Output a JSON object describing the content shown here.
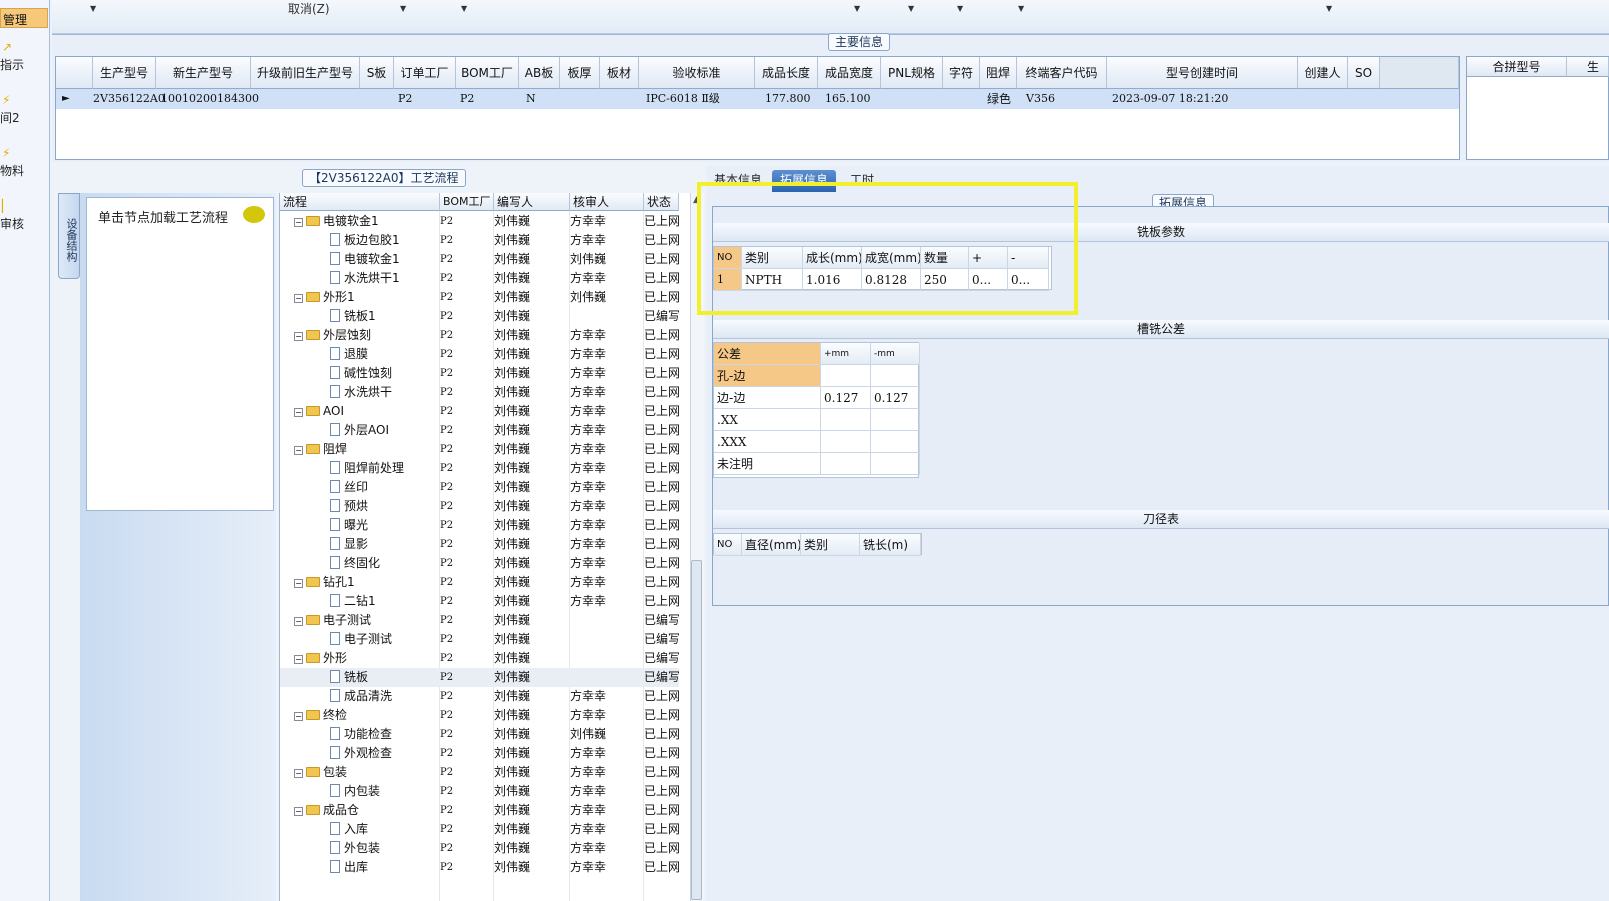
{
  "rail": {
    "items": [
      "管理",
      "指示",
      "间2",
      "物料",
      "审核"
    ]
  },
  "topbar": {
    "cancel": "取消(Z)"
  },
  "main": {
    "group_title": "主要信息",
    "columns": [
      "生产型号",
      "新生产型号",
      "升级前旧生产型号",
      "S板",
      "订单工厂",
      "BOM工厂",
      "AB板",
      "板厚",
      "板材",
      "验收标准",
      "成品长度",
      "成品宽度",
      "PNL规格",
      "字符",
      "阻焊",
      "终端客户代码",
      "型号创建时间",
      "创建人",
      "SO"
    ],
    "row": {
      "prod": "2V356122A0",
      "newprod": "10010200184300",
      "order_factory": "P2",
      "bom_factory": "P2",
      "ab": "N",
      "std": "IPC-6018 Ⅱ级",
      "len": "177.800",
      "wid": "165.100",
      "solder": "绿色",
      "customer": "V356",
      "created": "2023-09-07 18:21:20"
    },
    "merge_cols": [
      "合拼型号",
      "生"
    ]
  },
  "flow": {
    "title": "【2V356122A0】工艺流程",
    "vtab": "设备结构",
    "hint": "单击节点加载工艺流程",
    "columns": [
      "流程",
      "BOM工厂",
      "编写人",
      "核审人",
      "状态"
    ],
    "rows": [
      {
        "n": "电镀软金1",
        "lv": 0,
        "b": "P2",
        "w": "刘伟巍",
        "r": "方幸幸",
        "s": "已上网"
      },
      {
        "n": "板边包胶1",
        "lv": 1,
        "b": "P2",
        "w": "刘伟巍",
        "r": "方幸幸",
        "s": "已上网"
      },
      {
        "n": "电镀软金1",
        "lv": 1,
        "b": "P2",
        "w": "刘伟巍",
        "r": "刘伟巍",
        "s": "已上网"
      },
      {
        "n": "水洗烘干1",
        "lv": 1,
        "b": "P2",
        "w": "刘伟巍",
        "r": "方幸幸",
        "s": "已上网"
      },
      {
        "n": "外形1",
        "lv": 0,
        "b": "P2",
        "w": "刘伟巍",
        "r": "刘伟巍",
        "s": "已上网"
      },
      {
        "n": "铣板1",
        "lv": 1,
        "b": "P2",
        "w": "刘伟巍",
        "r": "",
        "s": "已编写"
      },
      {
        "n": "外层蚀刻",
        "lv": 0,
        "b": "P2",
        "w": "刘伟巍",
        "r": "方幸幸",
        "s": "已上网"
      },
      {
        "n": "退膜",
        "lv": 1,
        "b": "P2",
        "w": "刘伟巍",
        "r": "方幸幸",
        "s": "已上网"
      },
      {
        "n": "碱性蚀刻",
        "lv": 1,
        "b": "P2",
        "w": "刘伟巍",
        "r": "方幸幸",
        "s": "已上网"
      },
      {
        "n": "水洗烘干",
        "lv": 1,
        "b": "P2",
        "w": "刘伟巍",
        "r": "方幸幸",
        "s": "已上网"
      },
      {
        "n": "AOI",
        "lv": 0,
        "b": "P2",
        "w": "刘伟巍",
        "r": "方幸幸",
        "s": "已上网"
      },
      {
        "n": "外层AOI",
        "lv": 1,
        "b": "P2",
        "w": "刘伟巍",
        "r": "方幸幸",
        "s": "已上网"
      },
      {
        "n": "阻焊",
        "lv": 0,
        "b": "P2",
        "w": "刘伟巍",
        "r": "方幸幸",
        "s": "已上网"
      },
      {
        "n": "阻焊前处理",
        "lv": 1,
        "b": "P2",
        "w": "刘伟巍",
        "r": "方幸幸",
        "s": "已上网"
      },
      {
        "n": "丝印",
        "lv": 1,
        "b": "P2",
        "w": "刘伟巍",
        "r": "方幸幸",
        "s": "已上网"
      },
      {
        "n": "预烘",
        "lv": 1,
        "b": "P2",
        "w": "刘伟巍",
        "r": "方幸幸",
        "s": "已上网"
      },
      {
        "n": "曝光",
        "lv": 1,
        "b": "P2",
        "w": "刘伟巍",
        "r": "方幸幸",
        "s": "已上网"
      },
      {
        "n": "显影",
        "lv": 1,
        "b": "P2",
        "w": "刘伟巍",
        "r": "方幸幸",
        "s": "已上网"
      },
      {
        "n": "终固化",
        "lv": 1,
        "b": "P2",
        "w": "刘伟巍",
        "r": "方幸幸",
        "s": "已上网"
      },
      {
        "n": "钻孔1",
        "lv": 0,
        "b": "P2",
        "w": "刘伟巍",
        "r": "方幸幸",
        "s": "已上网"
      },
      {
        "n": "二钻1",
        "lv": 1,
        "b": "P2",
        "w": "刘伟巍",
        "r": "方幸幸",
        "s": "已上网"
      },
      {
        "n": "电子测试",
        "lv": 0,
        "b": "P2",
        "w": "刘伟巍",
        "r": "",
        "s": "已编写"
      },
      {
        "n": "电子测试",
        "lv": 1,
        "b": "P2",
        "w": "刘伟巍",
        "r": "",
        "s": "已编写"
      },
      {
        "n": "外形",
        "lv": 0,
        "b": "P2",
        "w": "刘伟巍",
        "r": "",
        "s": "已编写"
      },
      {
        "n": "铣板",
        "lv": 1,
        "b": "P2",
        "w": "刘伟巍",
        "r": "",
        "s": "已编写"
      },
      {
        "n": "成品清洗",
        "lv": 1,
        "b": "P2",
        "w": "刘伟巍",
        "r": "方幸幸",
        "s": "已上网"
      },
      {
        "n": "终检",
        "lv": 0,
        "b": "P2",
        "w": "刘伟巍",
        "r": "方幸幸",
        "s": "已上网"
      },
      {
        "n": "功能检查",
        "lv": 1,
        "b": "P2",
        "w": "刘伟巍",
        "r": "刘伟巍",
        "s": "已上网"
      },
      {
        "n": "外观检查",
        "lv": 1,
        "b": "P2",
        "w": "刘伟巍",
        "r": "方幸幸",
        "s": "已上网"
      },
      {
        "n": "包装",
        "lv": 0,
        "b": "P2",
        "w": "刘伟巍",
        "r": "方幸幸",
        "s": "已上网"
      },
      {
        "n": "内包装",
        "lv": 1,
        "b": "P2",
        "w": "刘伟巍",
        "r": "方幸幸",
        "s": "已上网"
      },
      {
        "n": "成品仓",
        "lv": 0,
        "b": "P2",
        "w": "刘伟巍",
        "r": "方幸幸",
        "s": "已上网"
      },
      {
        "n": "入库",
        "lv": 1,
        "b": "P2",
        "w": "刘伟巍",
        "r": "方幸幸",
        "s": "已上网"
      },
      {
        "n": "外包装",
        "lv": 1,
        "b": "P2",
        "w": "刘伟巍",
        "r": "方幸幸",
        "s": "已上网"
      },
      {
        "n": "出库",
        "lv": 1,
        "b": "P2",
        "w": "刘伟巍",
        "r": "方幸幸",
        "s": "已上网"
      }
    ]
  },
  "ext": {
    "tabs": [
      "基本信息",
      "拓展信息",
      "工时"
    ],
    "group_title": "拓展信息",
    "mill": {
      "title": "铣板参数",
      "headers": [
        "NO",
        "类别",
        "成长(mm)",
        "成宽(mm)",
        "数量",
        "+",
        "-"
      ],
      "row": [
        "1",
        "NPTH",
        "1.016",
        "0.8128",
        "250",
        "0...",
        "0..."
      ]
    },
    "tol": {
      "title": "槽铣公差",
      "headers": [
        "公差",
        "+mm",
        "-mm"
      ],
      "rows": [
        [
          "孔-边",
          "",
          ""
        ],
        [
          "边-边",
          "0.127",
          "0.127"
        ],
        [
          ".XX",
          "",
          ""
        ],
        [
          ".XXX",
          "",
          ""
        ],
        [
          "未注明",
          "",
          ""
        ]
      ]
    },
    "tool": {
      "title": "刀径表",
      "headers": [
        "NO",
        "直径(mm)",
        "类别",
        "铣长(m)"
      ]
    }
  },
  "colors": {
    "selected_row": "#cfe0f7",
    "highlight": "#f2ef2c",
    "active_tab": "#2c63b0",
    "orange_cell": "#f6c888"
  }
}
